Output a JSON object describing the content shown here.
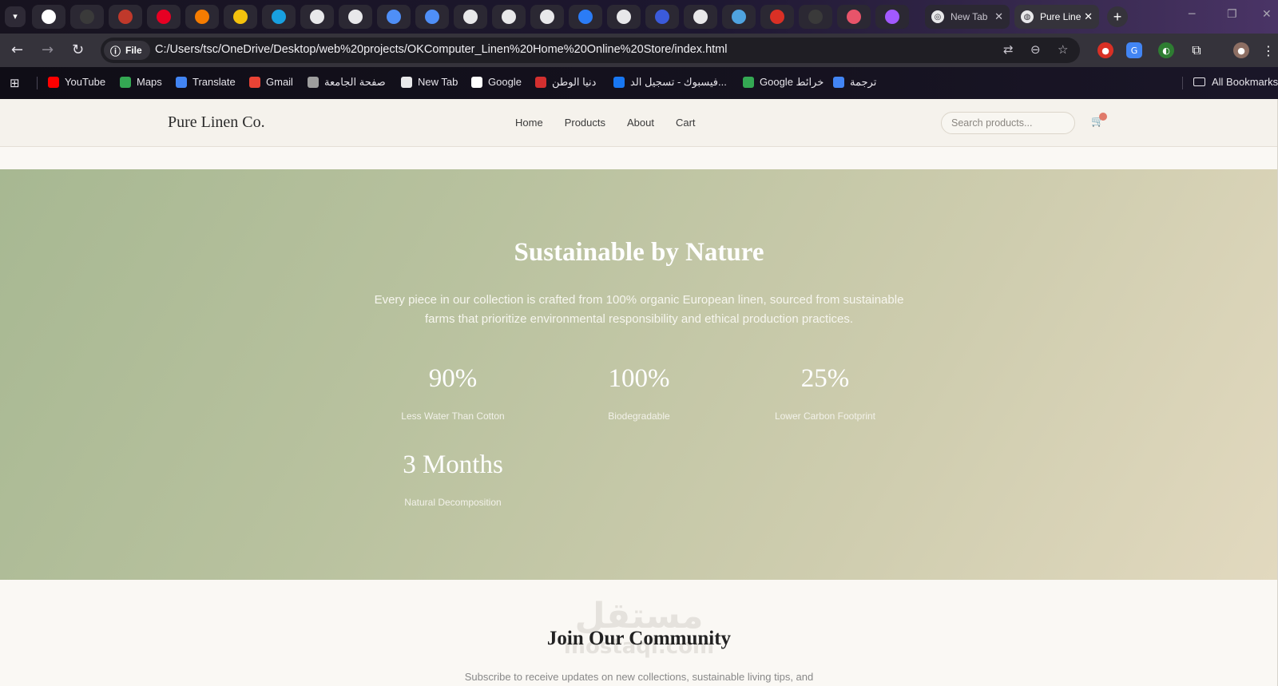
{
  "browser": {
    "tabs": [
      {
        "title": "New Tab",
        "active": false
      },
      {
        "title": "Pure Linen Co.",
        "active": true
      }
    ],
    "pinned_tabs": [
      {
        "icon": "google-icon",
        "color": "#ffffff"
      },
      {
        "icon": "chatgpt-icon",
        "color": "#3a3a3a"
      },
      {
        "icon": "speed-icon",
        "color": "#c0392b"
      },
      {
        "icon": "pinterest-icon",
        "color": "#e60023"
      },
      {
        "icon": "flame-icon",
        "color": "#f57c00"
      },
      {
        "icon": "yellow-app-icon",
        "color": "#f4c20d"
      },
      {
        "icon": "circle-app-icon",
        "color": "#18a0e0"
      },
      {
        "icon": "globe-icon",
        "color": "#e8e8ea"
      },
      {
        "icon": "globe-icon",
        "color": "#e8e8ea"
      },
      {
        "icon": "diamond-icon",
        "color": "#4f8ff7"
      },
      {
        "icon": "gemini-icon",
        "color": "#4f8ff7"
      },
      {
        "icon": "globe-icon",
        "color": "#e8e8ea"
      },
      {
        "icon": "globe-icon",
        "color": "#e8e8ea"
      },
      {
        "icon": "globe-icon",
        "color": "#e8e8ea"
      },
      {
        "icon": "moon-icon",
        "color": "#2b7cf6"
      },
      {
        "icon": "globe-icon",
        "color": "#e8e8ea"
      },
      {
        "icon": "bracket-app-icon",
        "color": "#3b5bdb"
      },
      {
        "icon": "globe-icon",
        "color": "#e8e8ea"
      },
      {
        "icon": "bowl-icon",
        "color": "#4fa3e0"
      },
      {
        "icon": "top-icon",
        "color": "#d93025"
      },
      {
        "icon": "openai-icon",
        "color": "#3a3a3a"
      },
      {
        "icon": "pie-icon",
        "color": "#e8546a"
      },
      {
        "icon": "figma-icon",
        "color": "#a259ff"
      }
    ],
    "tab_menu_icon": "chevron-down-icon",
    "address": {
      "chip": "File",
      "url": "C:/Users/tsc/OneDrive/Desktop/web%20projects/OKComputer_Linen%20Home%20Online%20Store/index.html"
    },
    "bookmarks": [
      {
        "label": "YouTube",
        "icon": "youtube-icon",
        "color": "#ff0000"
      },
      {
        "label": "Maps",
        "icon": "maps-icon",
        "color": "#34a853"
      },
      {
        "label": "Translate",
        "icon": "translate-icon",
        "color": "#4285f4"
      },
      {
        "label": "Gmail",
        "icon": "gmail-icon",
        "color": "#ea4335"
      },
      {
        "label": "صفحة الجامعة",
        "icon": "university-icon",
        "color": "#9e9e9e"
      },
      {
        "label": "New Tab",
        "icon": "globe-icon",
        "color": "#e8e8ea"
      },
      {
        "label": "Google",
        "icon": "google-icon",
        "color": "#ffffff"
      },
      {
        "label": "دنيا الوطن",
        "icon": "news-icon",
        "color": "#d32f2f"
      },
      {
        "label": "فيسبوك - تسجيل الد...",
        "icon": "facebook-icon",
        "color": "#1877f2"
      },
      {
        "label": "Google خرائط",
        "icon": "maps-icon",
        "color": "#34a853"
      },
      {
        "label": "ترجمة",
        "icon": "translate-icon",
        "color": "#4285f4"
      }
    ],
    "all_bookmarks": "All Bookmarks"
  },
  "site": {
    "logo": "Pure Linen Co.",
    "nav": [
      "Home",
      "Products",
      "About",
      "Cart"
    ],
    "search_placeholder": "Search products...",
    "cart_icon": "cart-icon",
    "hero": {
      "title": "Sustainable by Nature",
      "text": "Every piece in our collection is crafted from 100% organic European linen, sourced from sustainable farms that prioritize environmental responsibility and ethical production practices.",
      "stats": [
        {
          "value": "90%",
          "label": "Less Water Than Cotton"
        },
        {
          "value": "100%",
          "label": "Biodegradable"
        },
        {
          "value": "25%",
          "label": "Lower Carbon Footprint"
        },
        {
          "value": "3 Months",
          "label": "Natural Decomposition"
        }
      ]
    },
    "community": {
      "title": "Join Our Community",
      "text": "Subscribe to receive updates on new collections, sustainable living tips, and"
    },
    "watermark": {
      "arabic": "مستقل",
      "latin": "mostaql.com"
    }
  },
  "colors": {
    "hero_gradient_start": "#a7b892",
    "hero_gradient_end": "#e2d9bf",
    "header_bg": "#f5f2ec",
    "browser_frame": "#35333b"
  }
}
